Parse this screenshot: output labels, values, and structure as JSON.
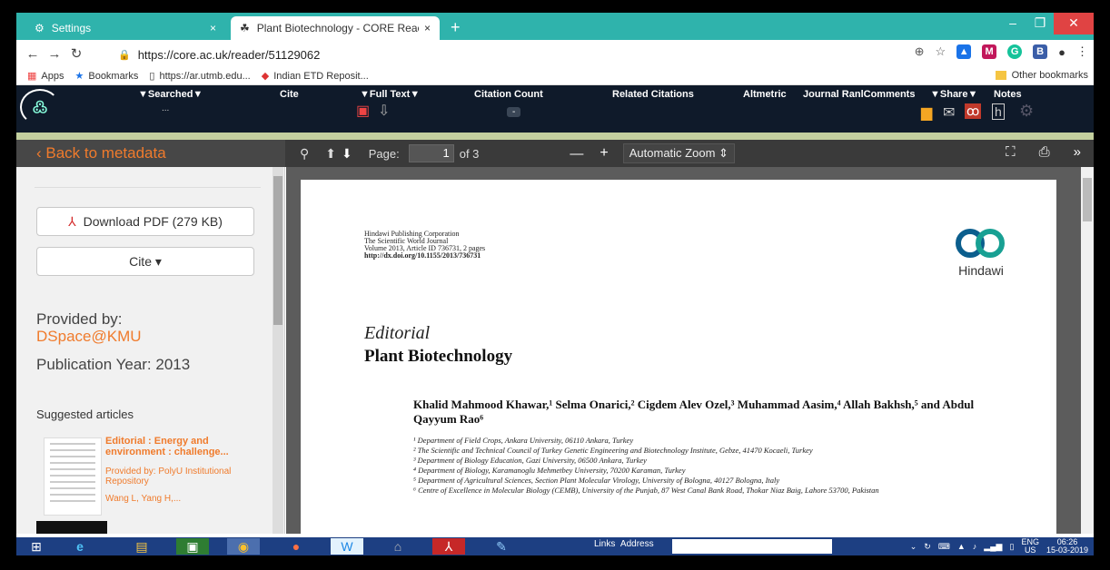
{
  "browser": {
    "tabs": [
      {
        "title": "Settings",
        "close": "×"
      },
      {
        "title": "Plant Biotechnology - CORE Reac",
        "close": "×"
      }
    ],
    "new_tab": "+",
    "url": "https://core.ac.uk/reader/51129062",
    "bookmarks": [
      {
        "label": "Apps"
      },
      {
        "label": "Bookmarks"
      },
      {
        "label": "https://ar.utmb.edu..."
      },
      {
        "label": "Indian ETD Reposit..."
      }
    ],
    "other_bookmarks": "Other bookmarks"
  },
  "core_header": {
    "items": [
      "▼Searched▼",
      "Cite",
      "▼Full Text▼",
      "Citation Count",
      "Related Citations",
      "Altmetric",
      "Journal RanlComments",
      "▼Share▼",
      "Notes"
    ],
    "searched_value": "...",
    "citation_value": "-"
  },
  "viewer": {
    "back_label": "Back to metadata",
    "page_label": "Page:",
    "page_current": "1",
    "page_of": "of 3",
    "zoom": "Automatic Zoom",
    "minus": "—",
    "plus": "+"
  },
  "sidebar": {
    "download_label": "Download PDF (279 KB)",
    "cite_label": "Cite",
    "provided_label": "Provided by:",
    "provided_value": "DSpace@KMU",
    "publication_year": "Publication Year: 2013",
    "suggested_heading": "Suggested articles",
    "suggested": {
      "title": "Editorial : Energy and environment : challenge...",
      "provided": "Provided by: PolyU Institutional Repository",
      "authors": "Wang L, Yang H,..."
    }
  },
  "document": {
    "publisher_lines": [
      "Hindawi Publishing Corporation",
      "The Scientific World Journal",
      "Volume 2013, Article ID 736731, 2 pages",
      "http://dx.doi.org/10.1155/2013/736731"
    ],
    "logo_name": "Hindawi",
    "type": "Editorial",
    "title": "Plant Biotechnology",
    "authors": "Khalid Mahmood Khawar,¹ Selma Onarici,² Cigdem Alev Ozel,³ Muhammad Aasim,⁴ Allah Bakhsh,⁵ and Abdul Qayyum Rao⁶",
    "affiliations": [
      "¹ Department of Field Crops, Ankara University, 06110 Ankara, Turkey",
      "² The Scientific and Technical Council of Turkey Genetic Engineering and Biotechnology Institute, Gebze, 41470 Kocaeli, Turkey",
      "³ Department of Biology Education, Gazi University, 06500 Ankara, Turkey",
      "⁴ Department of Biology, Karamanoglu Mehmetbey University, 70200 Karaman, Turkey",
      "⁵ Department of Agricultural Sciences, Section Plant Molecular Virology, University of Bologna, 40127 Bologna, Italy",
      "⁶ Centre of Excellence in Molecular Biology (CEMB), University of the Punjab, 87 West Canal Bank Road, Thokar Niaz Baig, Lahore 53700, Pakistan"
    ]
  },
  "taskbar": {
    "links": "Links",
    "address": "Address",
    "lang_top": "ENG",
    "lang_bottom": "US",
    "time": "06:26",
    "date": "15-03-2019"
  },
  "colors": {
    "accent": "#f07b2c",
    "tabbar": "#2fb3ac",
    "core_header": "#0f1a2a",
    "taskbar": "#1d3f82"
  }
}
